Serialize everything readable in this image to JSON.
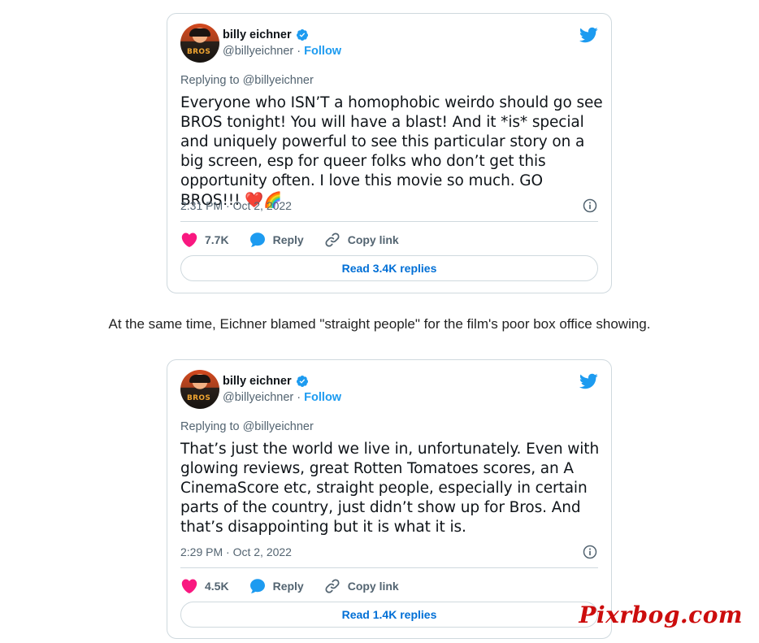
{
  "tweets": [
    {
      "author_name": "billy eichner",
      "handle": "@billyeichner",
      "separator": "·",
      "follow_label": "Follow",
      "avatar_text": "BROS",
      "replying_to": "Replying to @billyeichner",
      "text": "Everyone who ISN’T a homophobic weirdo should go see BROS tonight! You will have a blast! And it *is* special and uniquely powerful to see this particular story on a big screen, esp for queer folks who don’t get this opportunity often. I love this movie so much. GO BROS!!! ❤️🌈",
      "timestamp": "2:31 PM · Oct 2, 2022",
      "likes": "7.7K",
      "reply_label": "Reply",
      "copy_link_label": "Copy link",
      "read_replies": "Read 3.4K replies"
    },
    {
      "author_name": "billy eichner",
      "handle": "@billyeichner",
      "separator": "·",
      "follow_label": "Follow",
      "avatar_text": "BROS",
      "replying_to": "Replying to @billyeichner",
      "text": "That’s just the world we live in, unfortunately. Even with glowing reviews, great Rotten Tomatoes scores, an A CinemaScore etc, straight people, especially in certain parts of the country, just didn’t show up for Bros. And that’s disappointing but it is what it is.",
      "timestamp": "2:29 PM · Oct 2, 2022",
      "likes": "4.5K",
      "reply_label": "Reply",
      "copy_link_label": "Copy link",
      "read_replies": "Read 1.4K replies"
    }
  ],
  "caption": "At the same time, Eichner blamed \"straight people\" for the film's poor box office showing.",
  "watermark": "Pixrbog.com",
  "icons": [
    "verified-badge-icon",
    "twitter-bird-icon",
    "info-icon",
    "heart-icon",
    "reply-bubble-icon",
    "link-icon"
  ],
  "colors": {
    "accent": "#1d9bf0",
    "like": "#f91880",
    "link_text": "#006fd6",
    "watermark": "#cc0d0d"
  }
}
